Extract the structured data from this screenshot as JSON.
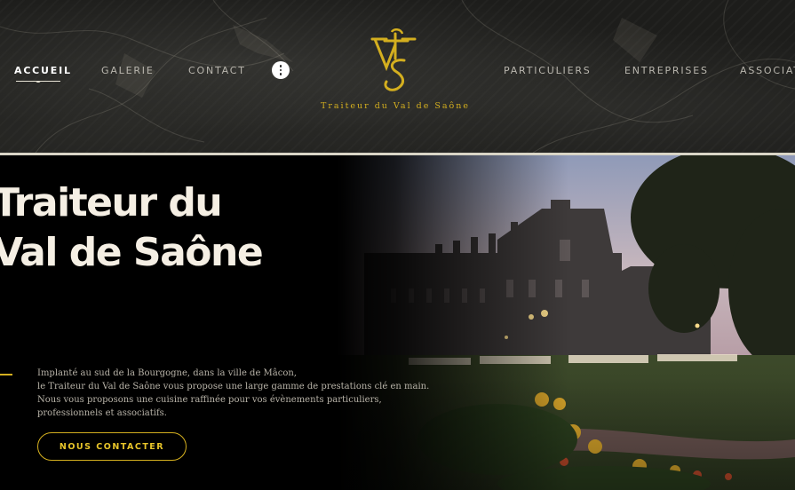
{
  "nav": {
    "left": [
      {
        "label": "ACCUEIL",
        "active": true
      },
      {
        "label": "GALERIE",
        "active": false
      },
      {
        "label": "CONTACT",
        "active": false
      }
    ],
    "right": [
      {
        "label": "PARTICULIERS"
      },
      {
        "label": "ENTREPRISES"
      },
      {
        "label": "ASSOCIATIONS"
      }
    ],
    "more_icon": "vertical-dots-icon"
  },
  "logo": {
    "monogram": "VTS",
    "text": "Traiteur du Val de Saône"
  },
  "hero": {
    "title_line1": "Traiteur du",
    "title_line2": "Val de Saône",
    "description": [
      "Implanté au sud de la Bourgogne, dans la ville de Mâcon,",
      "le Traiteur du Val de Saône vous propose une large gamme de prestations clé en main.",
      "Nous vous proposons une cuisine raffinée pour vos évènements particuliers,",
      "professionnels et associatifs."
    ],
    "cta_label": "NOUS CONTACTER"
  },
  "colors": {
    "gold": "#d4af1f",
    "header_bg": "#1d1d1b",
    "title": "#f5efe4",
    "text": "#b8b3a8"
  }
}
